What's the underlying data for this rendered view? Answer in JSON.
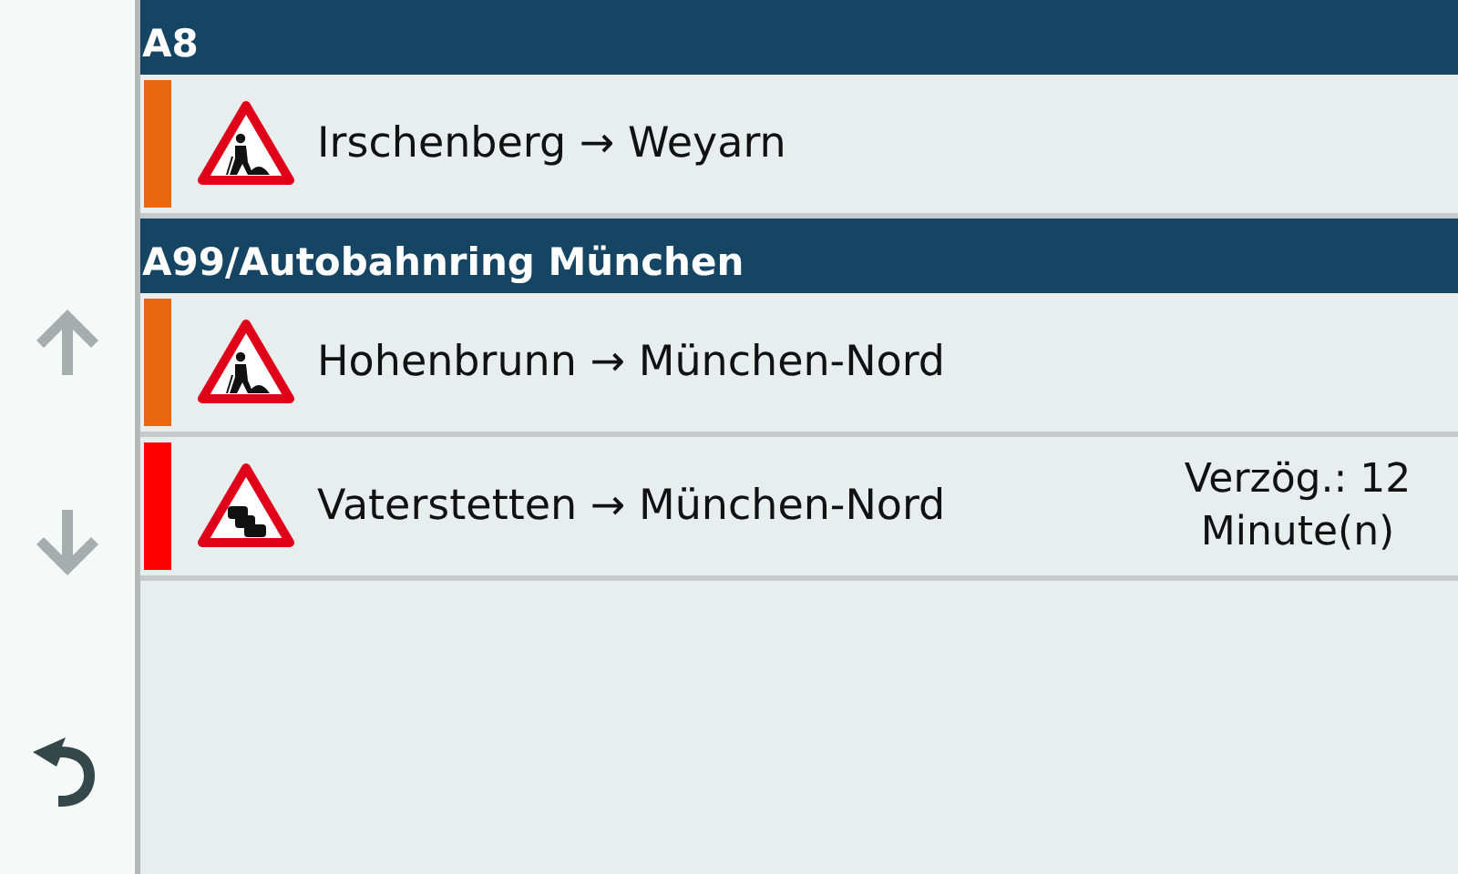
{
  "sidebar": {
    "buttons": [
      {
        "kind": "up",
        "disabled": true
      },
      {
        "kind": "down",
        "disabled": true
      },
      {
        "kind": "back",
        "disabled": false
      }
    ]
  },
  "groups": [
    {
      "road": "A8",
      "incidents": [
        {
          "kind": "roadwork",
          "color": "#e8680f",
          "route": "Irschenberg → Weyarn"
        }
      ]
    },
    {
      "road": "A99/Autobahnring München",
      "incidents": [
        {
          "kind": "roadwork",
          "color": "#e8680f",
          "route": "Hohenbrunn → München-Nord"
        },
        {
          "kind": "traffic_jam",
          "color": "#ff0000",
          "route": "Vaterstetten → München-Nord",
          "delay": "Verzög.: 12 Minute(n)"
        }
      ]
    }
  ]
}
